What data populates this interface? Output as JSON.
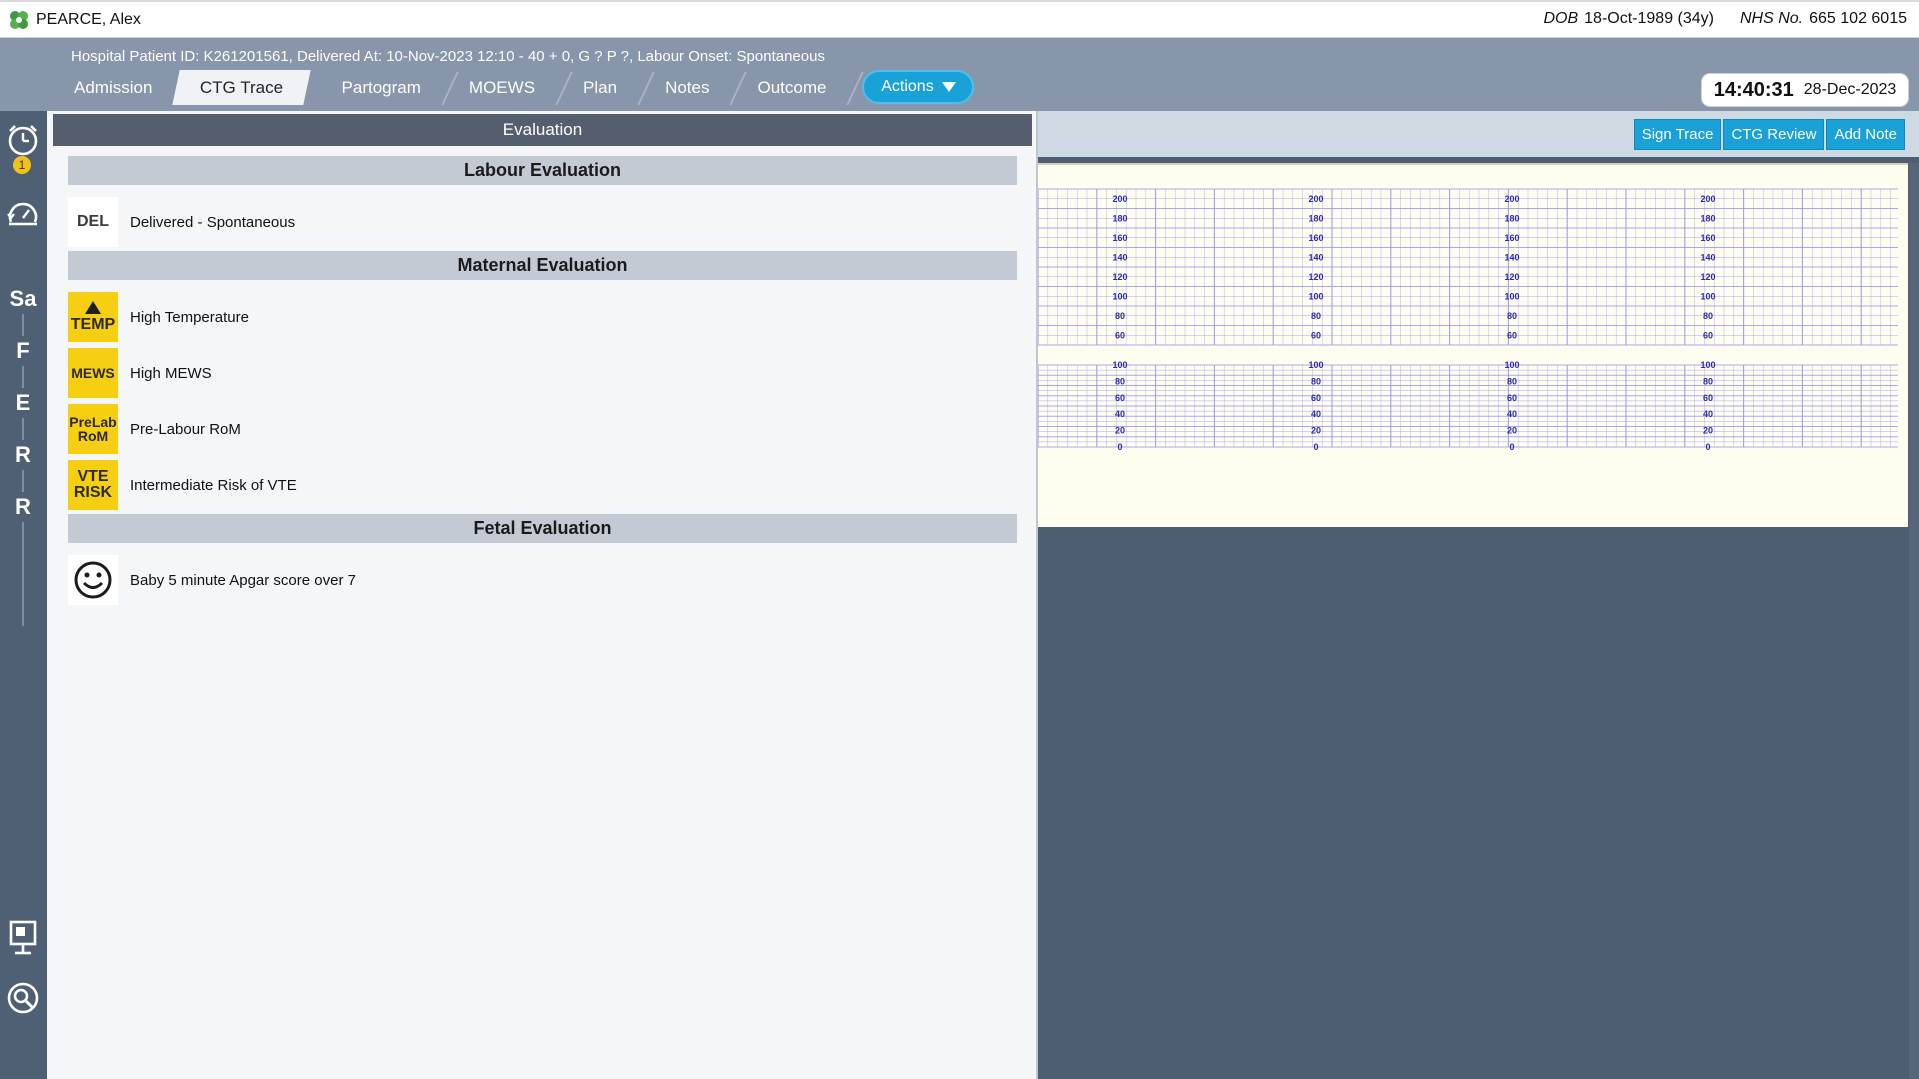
{
  "header": {
    "patient_name": "PEARCE, Alex",
    "dob_label": "DOB",
    "dob_value": "18-Oct-1989 (34y)",
    "nhs_label": "NHS No.",
    "nhs_value": "665 102 6015"
  },
  "banner": {
    "patient_info": "Hospital Patient ID: K261201561, Delivered At: 10-Nov-2023 12:10 - 40 + 0, G ? P ?,   Labour Onset: Spontaneous"
  },
  "tabs": [
    {
      "label": "Admission"
    },
    {
      "label": "CTG Trace"
    },
    {
      "label": "Partogram"
    },
    {
      "label": "MOEWS"
    },
    {
      "label": "Plan"
    },
    {
      "label": "Notes"
    },
    {
      "label": "Outcome"
    }
  ],
  "active_tab": "CTG Trace",
  "actions": {
    "label": "Actions"
  },
  "clock": {
    "time": "14:40:31",
    "date": "28-Dec-2023"
  },
  "sidebar": {
    "alarm_badge": "1",
    "letters": [
      "Sa",
      "F",
      "E",
      "R",
      "R"
    ]
  },
  "evaluation": {
    "title": "Evaluation",
    "labour": {
      "heading": "Labour Evaluation",
      "items": [
        {
          "badge": "DEL",
          "label": "Delivered - Spontaneous"
        }
      ]
    },
    "maternal": {
      "heading": "Maternal Evaluation",
      "items": [
        {
          "badge": "TEMP",
          "label": "High Temperature"
        },
        {
          "badge": "MEWS",
          "label": "High MEWS"
        },
        {
          "badge_line1": "PreLab",
          "badge_line2": "RoM",
          "label": "Pre-Labour RoM"
        },
        {
          "badge_line1": "VTE",
          "badge_line2": "RISK",
          "label": "Intermediate Risk of VTE"
        }
      ]
    },
    "fetal": {
      "heading": "Fetal Evaluation",
      "items": [
        {
          "icon": "smiley-icon",
          "label": "Baby 5 minute Apgar score over 7"
        }
      ]
    }
  },
  "toolbar": {
    "sign_trace": "Sign Trace",
    "ctg_review": "CTG Review",
    "add_note": "Add Note"
  },
  "chart_data": {
    "type": "line",
    "title": "",
    "fhr_scale": {
      "ticks": [
        200,
        180,
        160,
        140,
        120,
        100,
        80,
        60
      ],
      "ylim": [
        50,
        210
      ]
    },
    "toco_scale": {
      "ticks": [
        100,
        80,
        60,
        40,
        20,
        0
      ],
      "ylim": [
        0,
        100
      ]
    },
    "scale_label_repeats": 4,
    "series": []
  },
  "colors": {
    "banner": "#8796aa",
    "sidebar": "#4f6075",
    "accent": "#1aa1d8",
    "warning_badge": "#f7cf12",
    "grid_line": "#9a9af0",
    "scale_text": "#2a2ab0"
  }
}
